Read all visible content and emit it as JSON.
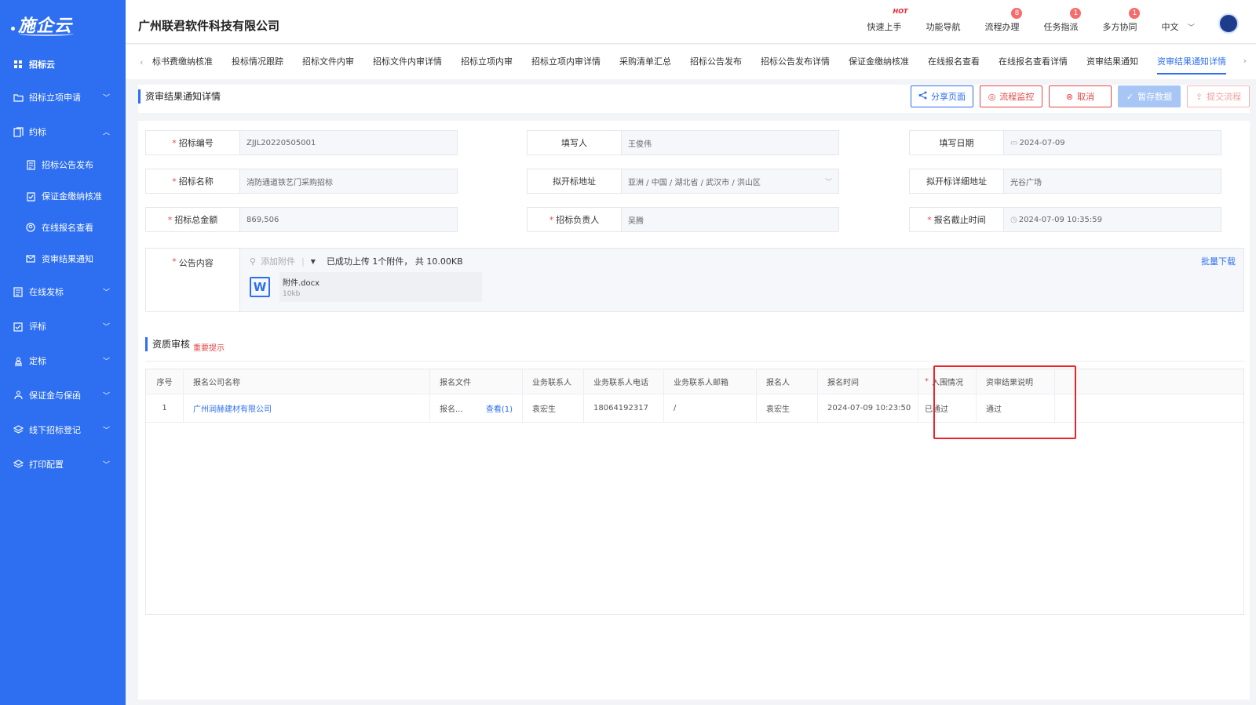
{
  "sidebar": {
    "logo": "施企云",
    "items": [
      {
        "label": "招标云",
        "type": "top"
      },
      {
        "label": "招标立项申请",
        "type": "group",
        "chevron": "down"
      },
      {
        "label": "约标",
        "type": "group",
        "chevron": "up"
      },
      {
        "label": "招标公告发布",
        "type": "sub"
      },
      {
        "label": "保证金缴纳核准",
        "type": "sub"
      },
      {
        "label": "在线报名查看",
        "type": "sub"
      },
      {
        "label": "资审结果通知",
        "type": "sub"
      },
      {
        "label": "在线发标",
        "type": "group",
        "chevron": "down"
      },
      {
        "label": "评标",
        "type": "group",
        "chevron": "down"
      },
      {
        "label": "定标",
        "type": "group",
        "chevron": "down"
      },
      {
        "label": "保证金与保函",
        "type": "group",
        "chevron": "down"
      },
      {
        "label": "线下招标登记",
        "type": "group",
        "chevron": "down"
      },
      {
        "label": "打印配置",
        "type": "group",
        "chevron": "down"
      }
    ]
  },
  "header": {
    "company": "广州联君软件科技有限公司",
    "links": [
      {
        "label": "快速上手",
        "hot": "HOT"
      },
      {
        "label": "功能导航"
      },
      {
        "label": "流程办理",
        "badge": "8"
      },
      {
        "label": "任务指派",
        "badge": "1"
      },
      {
        "label": "多方协同",
        "badge": "1"
      }
    ],
    "lang": "中文"
  },
  "tabs": [
    "标书费缴纳核准",
    "投标情况跟踪",
    "招标文件内审",
    "招标文件内审详情",
    "招标立项内审",
    "招标立项内审详情",
    "采购清单汇总",
    "招标公告发布",
    "招标公告发布详情",
    "保证金缴纳核准",
    "在线报名查看",
    "在线报名查看详情",
    "资审结果通知",
    "资审结果通知详情"
  ],
  "active_tab": "资审结果通知详情",
  "page": {
    "title": "资审结果通知详情",
    "actions": {
      "share": "分享页面",
      "monitor": "流程监控",
      "cancel": "取消",
      "save": "暂存数据",
      "submit": "提交流程"
    }
  },
  "form": {
    "bid_no": {
      "label": "招标编号",
      "value": "ZJJL20220505001"
    },
    "filler": {
      "label": "填写人",
      "value": "王俊伟"
    },
    "fill_date": {
      "label": "填写日期",
      "value": "2024-07-09"
    },
    "bid_name": {
      "label": "招标名称",
      "value": "消防通道铁艺门采购招标"
    },
    "open_addr": {
      "label": "拟开标地址",
      "value": "亚洲 / 中国 / 湖北省 / 武汉市 / 洪山区"
    },
    "open_addr_detail": {
      "label": "拟开标详细地址",
      "value": "光谷广场"
    },
    "total_amount": {
      "label": "招标总金额",
      "value": "869,506"
    },
    "principal": {
      "label": "招标负责人",
      "value": "吴腾"
    },
    "deadline": {
      "label": "报名截止时间",
      "value": "2024-07-09 10:35:59"
    },
    "content": {
      "label": "公告内容",
      "add_attachment": "添加附件",
      "upload_info": "已成功上传 1个附件，  共 10.00KB",
      "batch_download": "批量下载",
      "file_name": "附件.docx",
      "file_size": "10kb"
    }
  },
  "section": {
    "title": "资质审核",
    "tip": "重要提示"
  },
  "table": {
    "headers": [
      "序号",
      "报名公司名称",
      "报名文件",
      "业务联系人",
      "业务联系人电话",
      "业务联系人邮箱",
      "报名人",
      "报名时间",
      "入围情况",
      "资审结果说明"
    ],
    "rows": [
      [
        "1",
        "广州润赫建材有限公司",
        "报名...",
        "袁宏生",
        "18064192317",
        "/",
        "袁宏生",
        "2024-07-09 10:23:50",
        "已通过",
        "通过"
      ]
    ],
    "view_label": "查看(1)"
  },
  "colors": {
    "primary": "#2d6ff0",
    "danger": "#e34848",
    "highlight": "#e8232b"
  }
}
